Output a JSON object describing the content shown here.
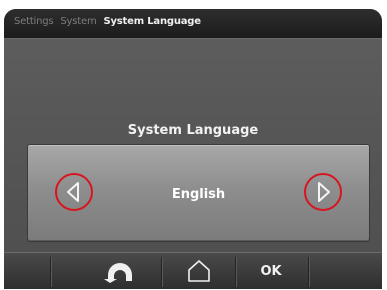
{
  "breadcrumb": {
    "items": [
      {
        "label": "Settings"
      },
      {
        "label": "System"
      },
      {
        "label": "System Language"
      }
    ]
  },
  "section": {
    "title": "System Language"
  },
  "selector": {
    "value": "English",
    "prev_icon": "chevron-left-icon",
    "next_icon": "chevron-right-icon",
    "highlight_color": "#d8151e"
  },
  "toolbar": {
    "back_icon": "back-arrow-icon",
    "home_icon": "home-icon",
    "ok_label": "OK"
  }
}
